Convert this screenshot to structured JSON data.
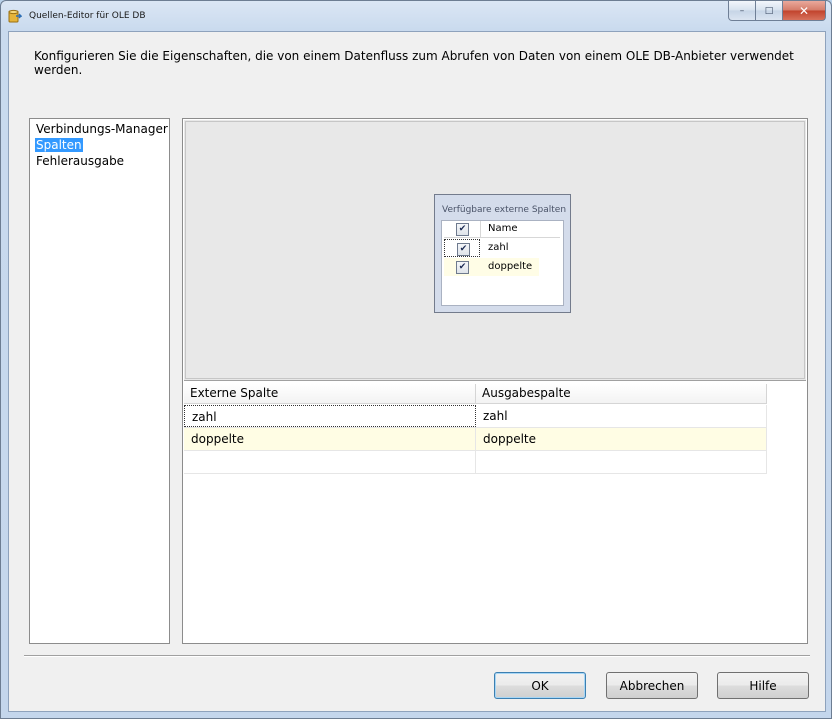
{
  "window": {
    "title": "Quellen-Editor für OLE DB",
    "controls": {
      "minimize": "–",
      "maximize": "□",
      "close": "✕"
    }
  },
  "description": "Konfigurieren Sie die Eigenschaften, die von einem Datenfluss zum Abrufen von Daten von einem OLE DB-Anbieter verwendet werden.",
  "sidebar": {
    "items": [
      {
        "label": "Verbindungs-Manager",
        "selected": false
      },
      {
        "label": "Spalten",
        "selected": true
      },
      {
        "label": "Fehlerausgabe",
        "selected": false
      }
    ]
  },
  "columns_box": {
    "title": "Verfügbare externe Spalten",
    "header": "Name",
    "header_checked": true,
    "rows": [
      {
        "name": "zahl",
        "checked": true
      },
      {
        "name": "doppelte",
        "checked": true
      }
    ]
  },
  "mapping": {
    "columns": [
      "Externe Spalte",
      "Ausgabespalte"
    ],
    "rows": [
      [
        "zahl",
        "zahl"
      ],
      [
        "doppelte",
        "doppelte"
      ]
    ]
  },
  "buttons": {
    "ok": "OK",
    "cancel": "Abbrechen",
    "help": "Hilfe"
  },
  "colors": {
    "selection": "#3399ff",
    "row_highlight": "#fffde4"
  },
  "icons": {
    "app": "database-source-icon",
    "checkbox": "checkmark-icon"
  }
}
